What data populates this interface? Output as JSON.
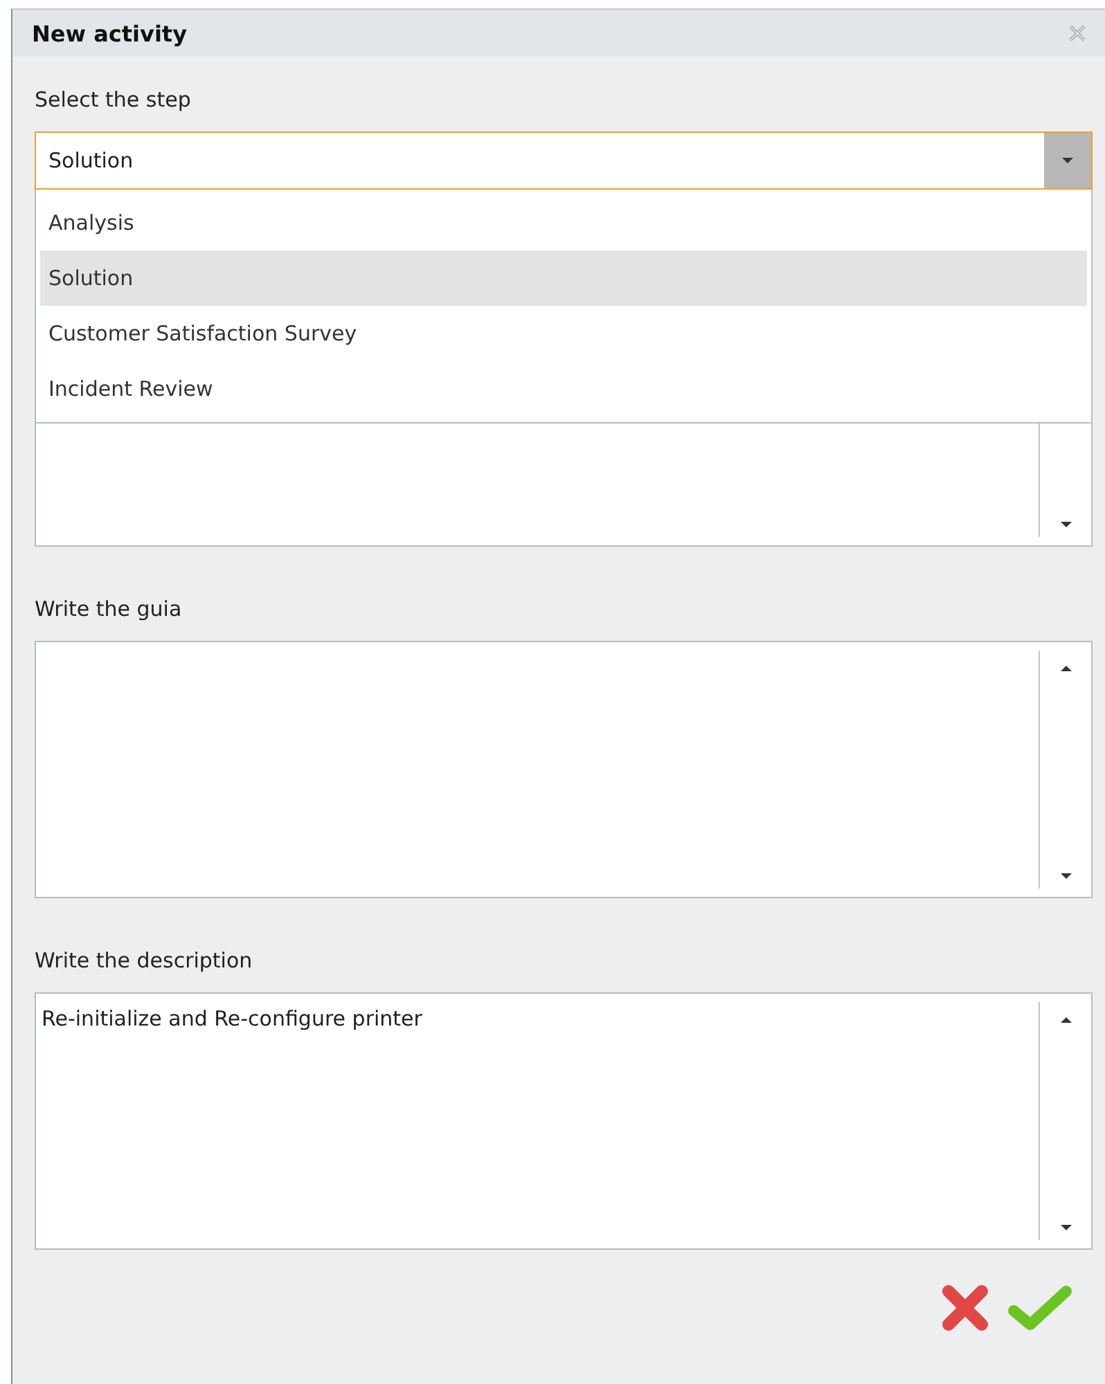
{
  "window": {
    "title": "New activity"
  },
  "step": {
    "label": "Select the step",
    "value": "Solution",
    "expanded": true,
    "options": [
      {
        "label": "Analysis",
        "selected": false
      },
      {
        "label": "Solution",
        "selected": true
      },
      {
        "label": "Customer Satisfaction Survey",
        "selected": false
      },
      {
        "label": "Incident Review",
        "selected": false
      }
    ]
  },
  "fields": [
    {
      "label": "Write the guia"
    },
    {
      "label": "Write the description",
      "value": "Re-initialize and Re-configure printer"
    }
  ]
}
